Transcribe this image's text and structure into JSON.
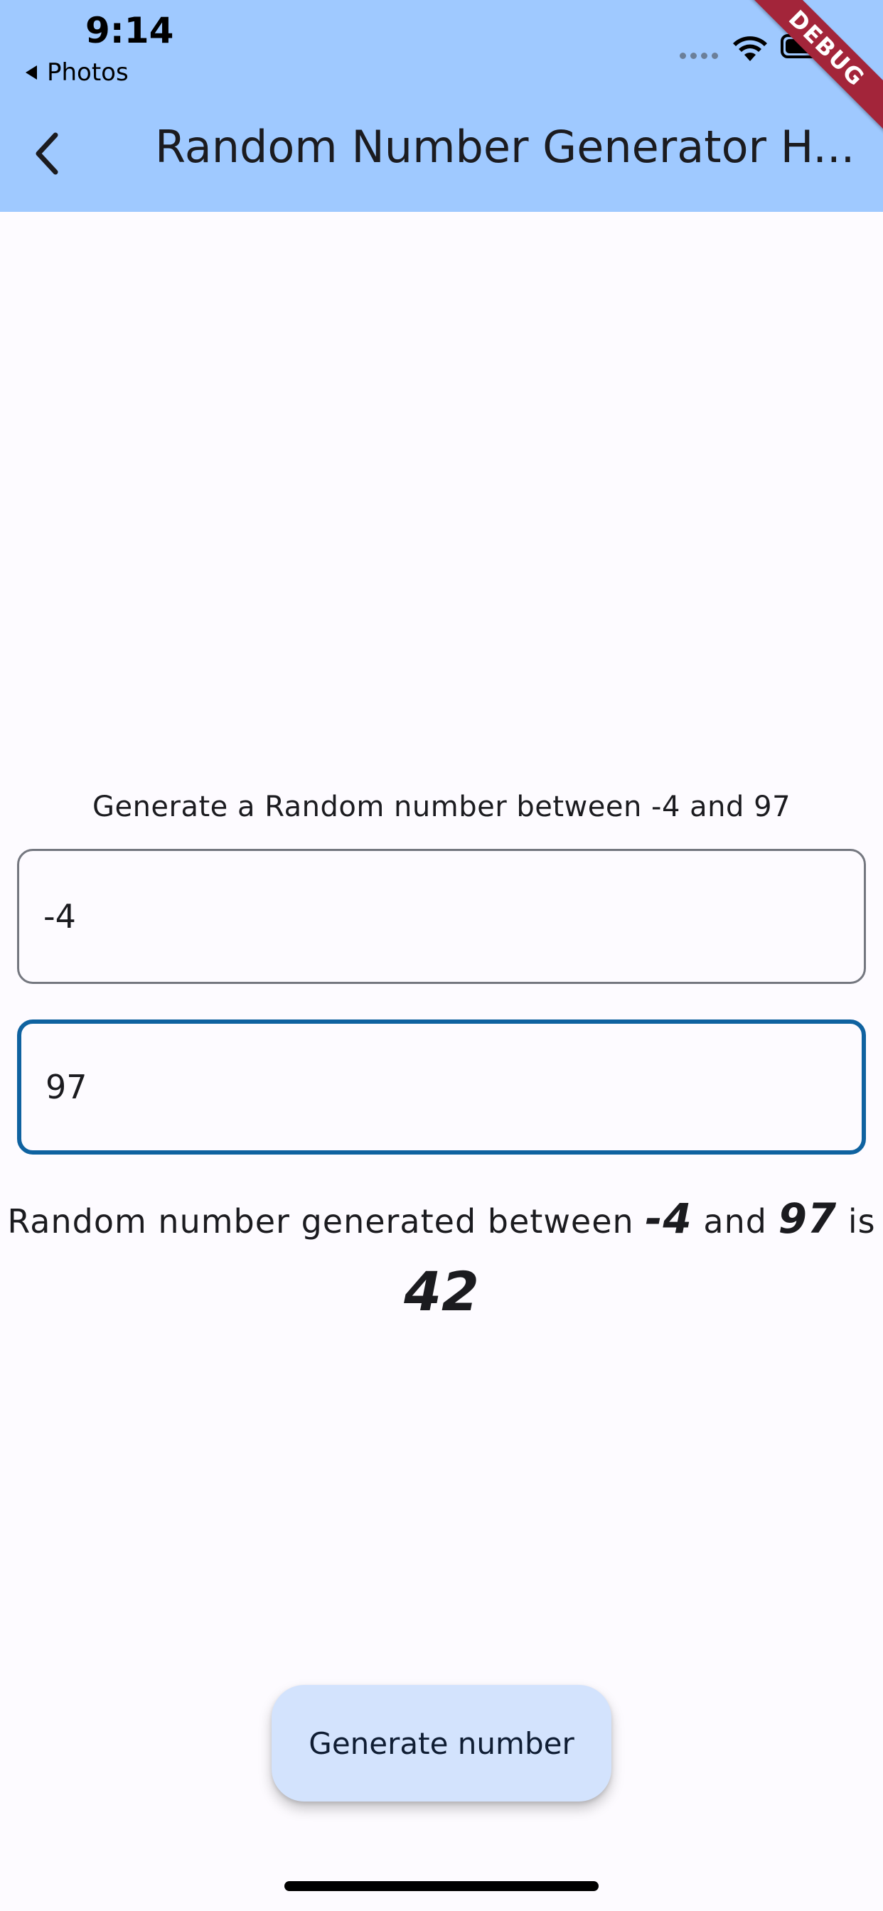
{
  "status_bar": {
    "time": "9:14",
    "back_app": "Photos"
  },
  "debug_banner": "DEBUG",
  "app_bar": {
    "title": "Random Number Generator H..."
  },
  "prompt_text": "Generate a Random number between -4 and 97",
  "inputs": {
    "min_value": "-4",
    "max_value": "97"
  },
  "result": {
    "prefix": "Random number generated between",
    "min": "-4",
    "conjunction": "and",
    "max": "97",
    "suffix": "is",
    "value": "42"
  },
  "button": {
    "label": "Generate number"
  },
  "colors": {
    "app_bar": "#9fc9ff",
    "focused_border": "#0f62a0",
    "button_bg": "#d3e3fd",
    "debug_banner": "#a3253a"
  }
}
